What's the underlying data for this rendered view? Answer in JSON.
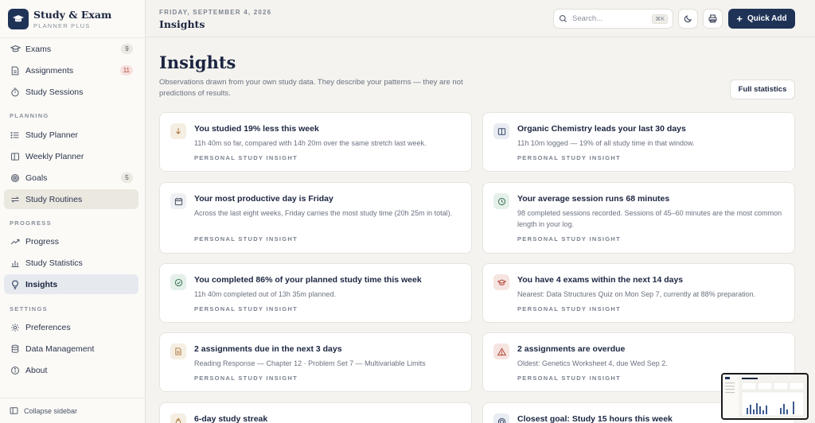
{
  "brand": {
    "title": "Study & Exam",
    "subtitle": "PLANNER PLUS"
  },
  "sidebar": {
    "top_items": [
      {
        "label": "Exams",
        "badge": "9",
        "icon": "graduation-cap-icon"
      },
      {
        "label": "Assignments",
        "badge": "11",
        "icon": "document-icon"
      },
      {
        "label": "Study Sessions",
        "icon": "timer-icon"
      }
    ],
    "planning_label": "PLANNING",
    "planning_items": [
      {
        "label": "Study Planner",
        "icon": "list-icon"
      },
      {
        "label": "Weekly Planner",
        "icon": "columns-icon"
      },
      {
        "label": "Goals",
        "badge": "5",
        "icon": "target-icon"
      },
      {
        "label": "Study Routines",
        "icon": "repeat-icon"
      }
    ],
    "progress_label": "PROGRESS",
    "progress_items": [
      {
        "label": "Progress",
        "icon": "trend-icon"
      },
      {
        "label": "Study Statistics",
        "icon": "bar-chart-icon"
      },
      {
        "label": "Insights",
        "icon": "lightbulb-icon"
      }
    ],
    "settings_label": "SETTINGS",
    "settings_items": [
      {
        "label": "Preferences",
        "icon": "gear-icon"
      },
      {
        "label": "Data Management",
        "icon": "database-icon"
      },
      {
        "label": "About",
        "icon": "info-icon"
      }
    ],
    "collapse_label": "Collapse sidebar"
  },
  "topbar": {
    "date": "FRIDAY, SEPTEMBER 4, 2026",
    "title": "Insights",
    "search_placeholder": "Search...",
    "search_shortcut": "⌘K",
    "quick_add": "Quick Add"
  },
  "main": {
    "title": "Insights",
    "intro": "Observations drawn from your own study data. They describe your patterns — they are not predictions of results.",
    "full_stats": "Full statistics"
  },
  "insights": [
    {
      "icon": "arrow-down-icon",
      "title": "You studied 19% less this week",
      "body": "11h 40m so far, compared with 14h 20m over the same stretch last week.",
      "tag": "PERSONAL STUDY INSIGHT",
      "tone": "#f5eee2"
    },
    {
      "icon": "book-icon",
      "title": "Organic Chemistry leads your last 30 days",
      "body": "11h 10m logged — 19% of all study time in that window.",
      "tag": "PERSONAL STUDY INSIGHT",
      "tone": "#e9ecf2"
    },
    {
      "icon": "calendar-icon",
      "title": "Your most productive day is Friday",
      "body": "Across the last eight weeks, Friday carries the most study time (20h 25m in total).",
      "tag": "PERSONAL STUDY INSIGHT",
      "tone": "#eef0f3"
    },
    {
      "icon": "clock-icon",
      "title": "Your average session runs 68 minutes",
      "body": "98 completed sessions recorded. Sessions of 45–60 minutes are the most common length in your log.",
      "tag": "PERSONAL STUDY INSIGHT",
      "tone": "#e6f0ea"
    },
    {
      "icon": "check-circle-icon",
      "title": "You completed 86% of your planned study time this week",
      "body": "11h 40m completed out of 13h 35m planned.",
      "tag": "PERSONAL STUDY INSIGHT",
      "tone": "#e6f0ea"
    },
    {
      "icon": "graduation-cap-icon",
      "title": "You have 4 exams within the next 14 days",
      "body": "Nearest: Data Structures Quiz on Mon Sep 7, currently at 88% preparation.",
      "tag": "PERSONAL STUDY INSIGHT",
      "tone": "#f6e4e1"
    },
    {
      "icon": "document-icon",
      "title": "2 assignments due in the next 3 days",
      "body": "Reading Response — Chapter 12 · Problem Set 7 — Multivariable Limits",
      "tag": "PERSONAL STUDY INSIGHT",
      "tone": "#f5eee2"
    },
    {
      "icon": "warning-icon",
      "title": "2 assignments are overdue",
      "body": "Oldest: Genetics Worksheet 4, due Wed Sep 2.",
      "tag": "PERSONAL STUDY INSIGHT",
      "tone": "#f6e4e1"
    },
    {
      "icon": "flame-icon",
      "title": "6-day study streak",
      "body": "",
      "tag": "",
      "tone": "#f5eee2"
    },
    {
      "icon": "target-icon",
      "title": "Closest goal: Study 15 hours this week",
      "body": "",
      "tag": "",
      "tone": "#e9ecf2"
    }
  ]
}
